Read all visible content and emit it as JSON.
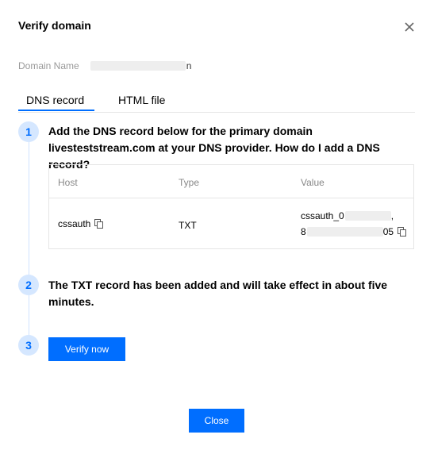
{
  "dialog": {
    "title": "Verify domain",
    "close_icon": "close-icon"
  },
  "domain": {
    "label": "Domain Name",
    "value_visible": "n"
  },
  "tabs": [
    {
      "label": "DNS record",
      "active": true
    },
    {
      "label": "HTML file",
      "active": false
    }
  ],
  "steps": [
    {
      "number": "1",
      "text": "Add the DNS record below for the primary domain livesteststream.com at your DNS provider.",
      "link": "How do I add a DNS record?"
    },
    {
      "number": "2",
      "text": "The TXT record has been added and will take effect in about five minutes."
    },
    {
      "number": "3"
    }
  ],
  "dns_table": {
    "headers": [
      "Host",
      "Type",
      "Value"
    ],
    "row": {
      "host": "cssauth",
      "type": "TXT",
      "value_line1": "cssauth_0",
      "value_line2_start": "8",
      "value_line2_end": "05"
    }
  },
  "buttons": {
    "verify": "Verify now",
    "close": "Close"
  },
  "colors": {
    "accent": "#006eff",
    "step_bg": "#d5e7ff",
    "muted": "#888888"
  }
}
